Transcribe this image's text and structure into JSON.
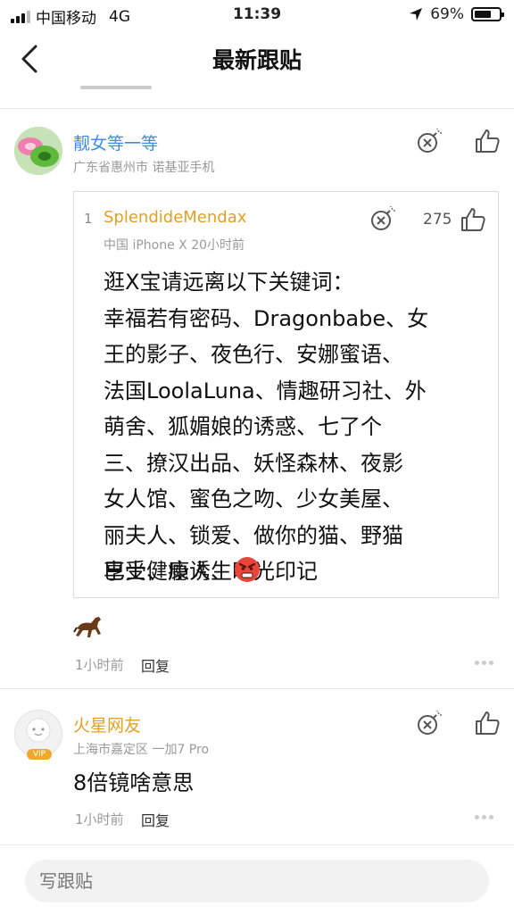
{
  "status_bar": {
    "carrier": "中国移动",
    "network": "4G",
    "time": "11:39",
    "battery": "69%",
    "battery_level": 0.69
  },
  "nav": {
    "title": "最新跟贴",
    "back_icon": "chevron-left-icon"
  },
  "comments": [
    {
      "username": "靓女等一等",
      "meta": "广东省惠州市  诺基亚手机",
      "username_color": "#3a8ee6",
      "quote": {
        "floor": "1",
        "username": "SplendideMendax",
        "meta": "中国  iPhone X  20小时前",
        "like_count": "275",
        "lines": [
          "逛X宝请远离以下关键词：",
          "幸福若有密码、Dragonbabe、女",
          "王的影子、夜色行、安娜蜜语、",
          "法国LoolaLuna、情趣研习社、外",
          "萌舍、狐媚娘的诱惑、七了个",
          "三、撩汉出品、妖怪森林、夜影",
          "女人馆、蜜色之吻、少女美屋、",
          "丽夫人、锁爱、做你的猫、野猫",
          "巴士、瘾诱、时光印记"
        ],
        "closing": "享受健康人生"
      },
      "time": "1小时前",
      "reply_label": "回复"
    },
    {
      "username": "火星网友",
      "meta": "上海市嘉定区  一加7 Pro",
      "username_color": "#e6a021",
      "badge": "VIP",
      "text": "8倍镜啥意思",
      "time": "1小时前",
      "reply_label": "回复"
    }
  ],
  "reply_bar": {
    "placeholder": "写跟贴"
  }
}
